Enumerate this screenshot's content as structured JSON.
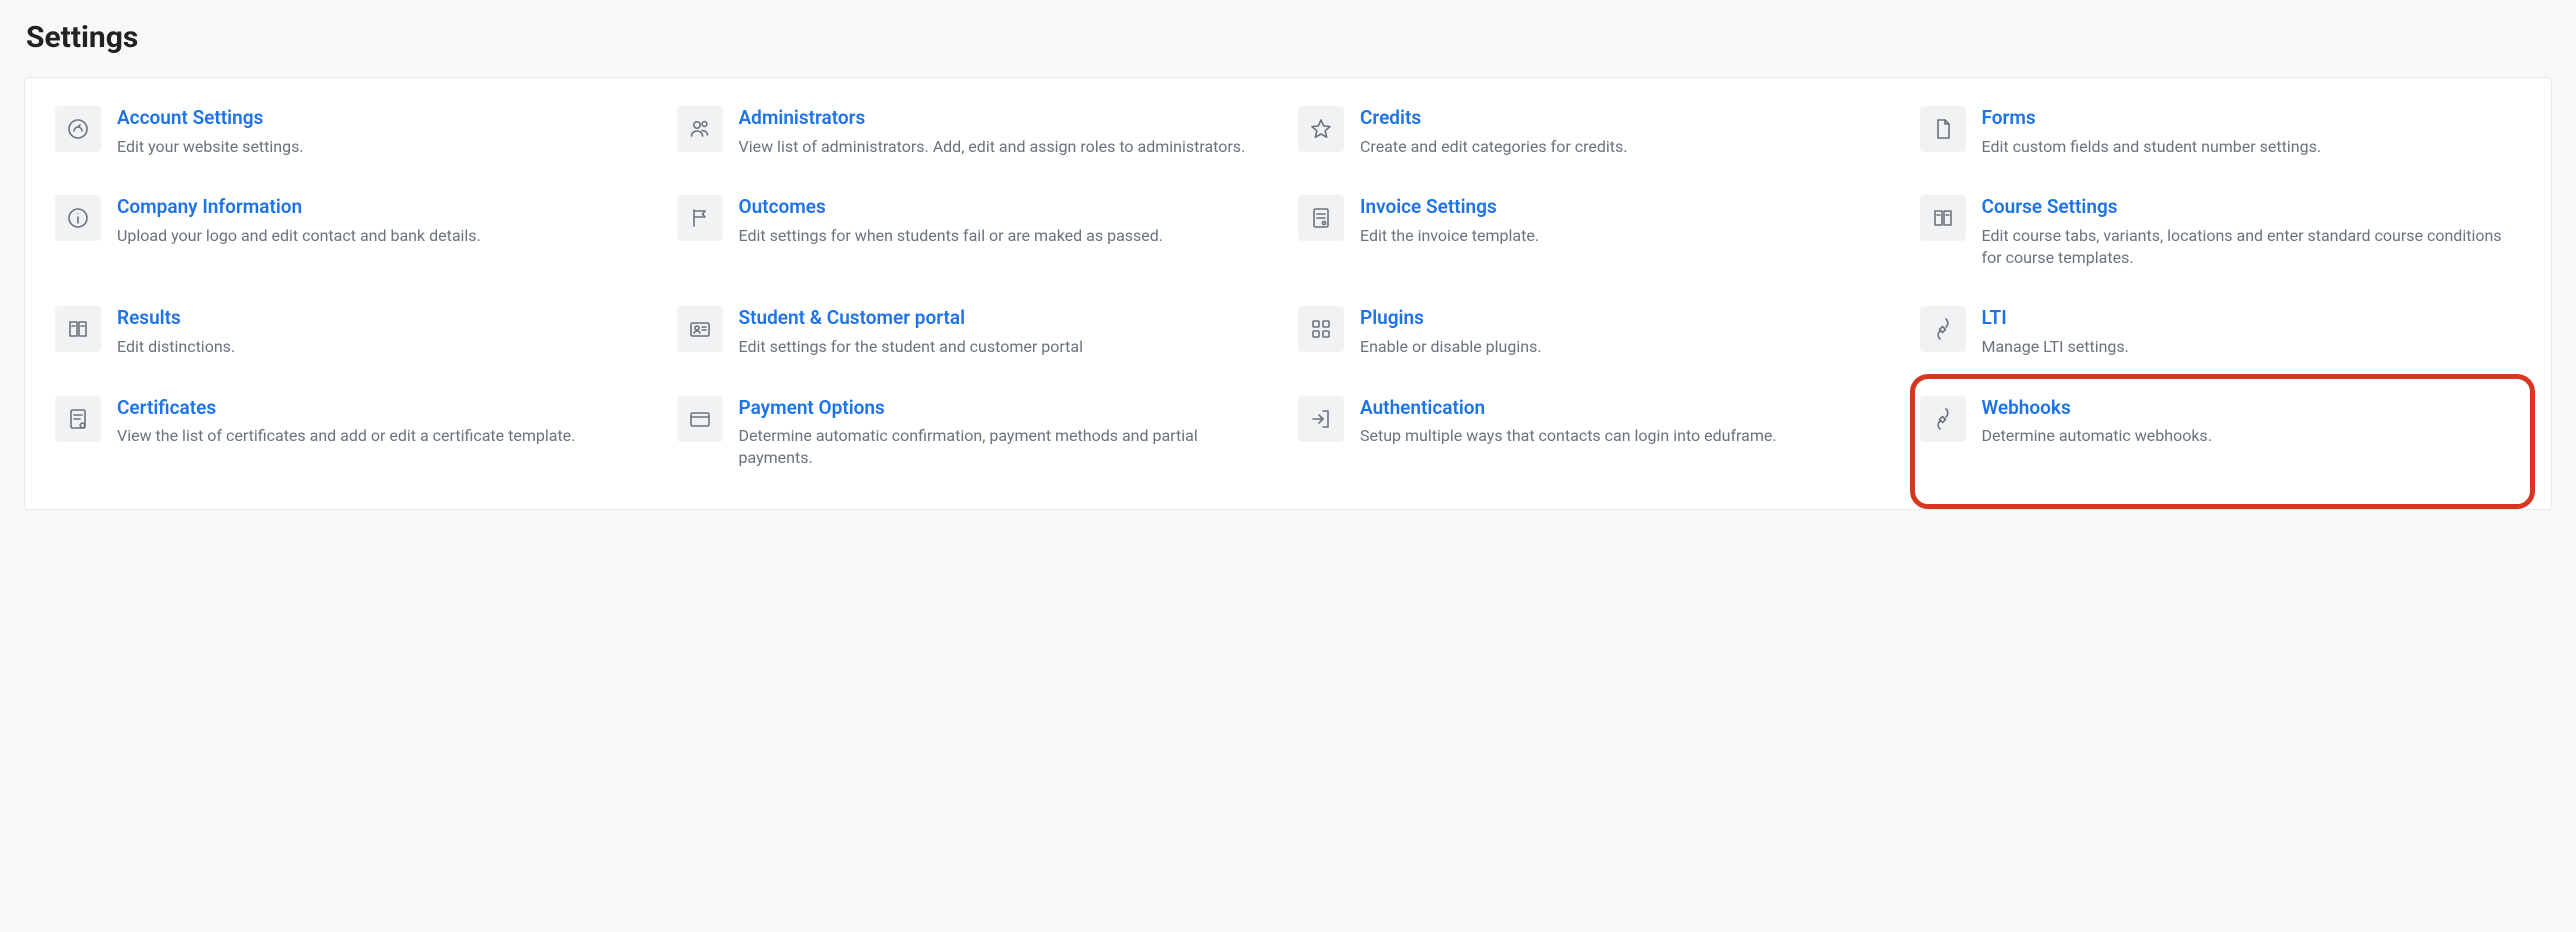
{
  "page_title": "Settings",
  "tiles": [
    {
      "icon": "gauge",
      "title": "Account Settings",
      "desc": "Edit your website settings."
    },
    {
      "icon": "users",
      "title": "Administrators",
      "desc": "View list of administrators. Add, edit and assign roles to administrators."
    },
    {
      "icon": "star",
      "title": "Credits",
      "desc": "Create and edit categories for credits."
    },
    {
      "icon": "file",
      "title": "Forms",
      "desc": "Edit custom fields and student number settings."
    },
    {
      "icon": "info",
      "title": "Company Information",
      "desc": "Upload your logo and edit contact and bank details."
    },
    {
      "icon": "flag",
      "title": "Outcomes",
      "desc": "Edit settings for when students fail or are maked as passed."
    },
    {
      "icon": "invoice",
      "title": "Invoice Settings",
      "desc": "Edit the invoice template."
    },
    {
      "icon": "book",
      "title": "Course Settings",
      "desc": "Edit course tabs, variants, locations and enter standard course conditions for course templates."
    },
    {
      "icon": "book",
      "title": "Results",
      "desc": "Edit distinctions."
    },
    {
      "icon": "idcard",
      "title": "Student & Customer portal",
      "desc": "Edit settings for the student and customer portal"
    },
    {
      "icon": "grid",
      "title": "Plugins",
      "desc": "Enable or disable plugins."
    },
    {
      "icon": "plug",
      "title": "LTI",
      "desc": "Manage LTI settings."
    },
    {
      "icon": "cert",
      "title": "Certificates",
      "desc": "View the list of certificates and add or edit a certificate template."
    },
    {
      "icon": "card",
      "title": "Payment Options",
      "desc": "Determine automatic confirmation, payment methods and partial payments."
    },
    {
      "icon": "login",
      "title": "Authentication",
      "desc": "Setup multiple ways that contacts can login into eduframe."
    },
    {
      "icon": "plug",
      "title": "Webhooks",
      "desc": "Determine automatic webhooks.",
      "highlight": true
    }
  ]
}
